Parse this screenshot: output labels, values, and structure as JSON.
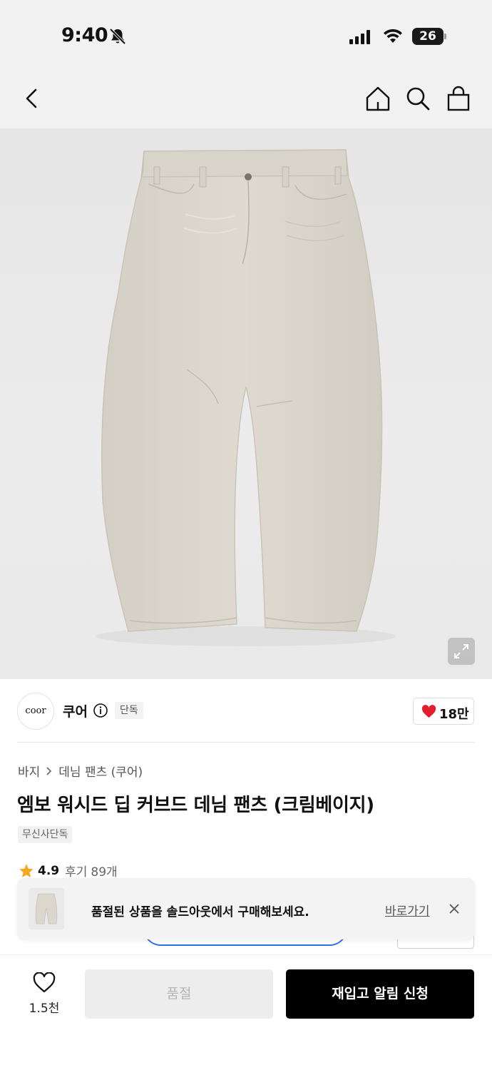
{
  "status_bar": {
    "time": "9:40",
    "battery_level": "26",
    "icons": [
      "bell-off-icon",
      "signal-icon",
      "wifi-icon",
      "battery-icon"
    ]
  },
  "nav": {
    "icons": [
      "back-arrow-icon",
      "home-icon",
      "search-icon",
      "shopping-bag-icon"
    ]
  },
  "hero": {
    "icon": "expand-icon",
    "product_color": "#dcd7cd"
  },
  "brand": {
    "logo_text": "coor",
    "name": "쿠어",
    "exclusive_badge": "단독",
    "likes": "18만",
    "like_color": "#e21d2d"
  },
  "breadcrumb": {
    "category": "바지",
    "subcategory": "데님 팬츠 (쿠어)"
  },
  "product": {
    "title": "엠보 워시드 딥 커브드 데님 팬츠 (크림베이지)",
    "tag": "무신사단독"
  },
  "rating": {
    "score": "4.9",
    "review_label": "후기",
    "review_count": "89개",
    "star_color": "#f5a623"
  },
  "toast": {
    "message": "품절된 상품을 솔드아웃에서 구매해보세요.",
    "link": "바로가기"
  },
  "bottom_bar": {
    "wishlist_count": "1.5천",
    "soldout_label": "품절",
    "restock_label": "재입고 알림 신청"
  }
}
